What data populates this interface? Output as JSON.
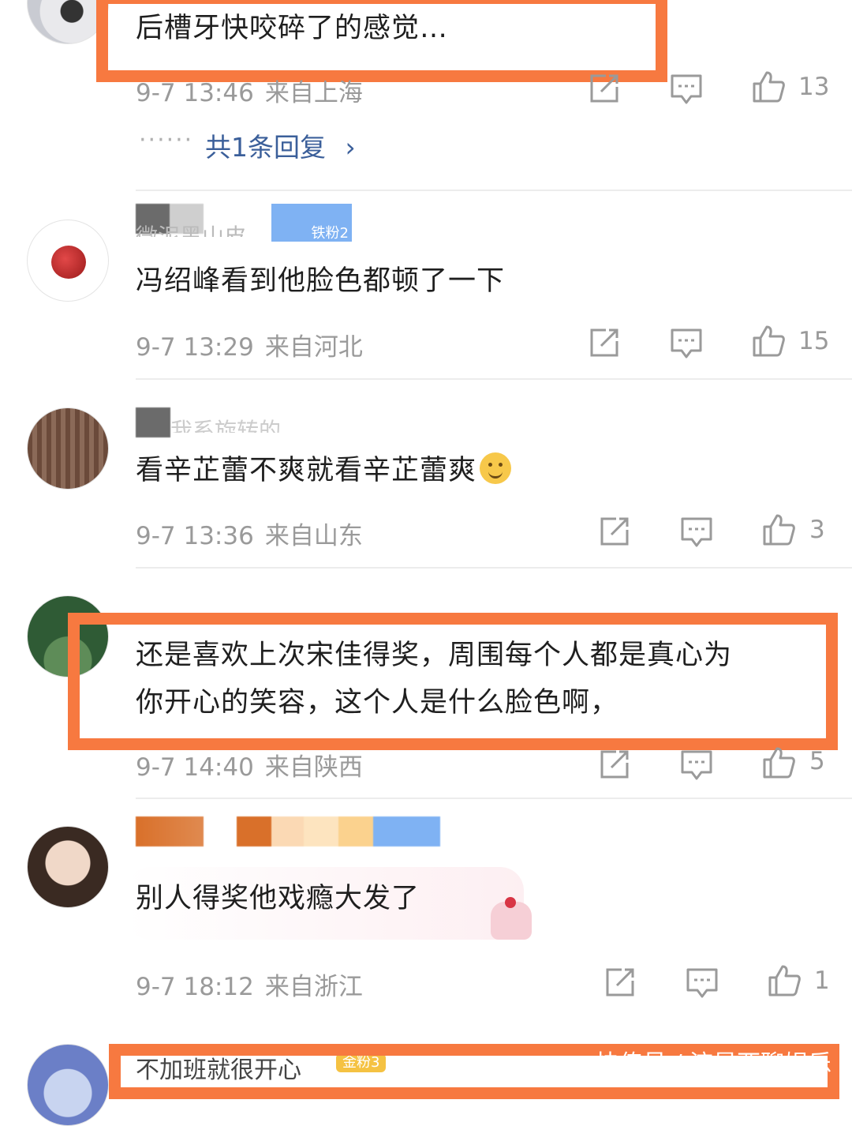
{
  "comments": [
    {
      "text": "后槽牙快咬碎了的感觉…",
      "date": "9-7 13:46",
      "location": "来自上海",
      "likes": "13",
      "reply_link": "共1条回复",
      "reply_dots": "······"
    },
    {
      "name": "微泥黑山皮",
      "badge": "铁粉2",
      "text": "冯绍峰看到他脸色都顿了一下",
      "date": "9-7 13:29",
      "location": "来自河北",
      "likes": "15"
    },
    {
      "name": "我系旋转的",
      "text": "看辛芷蕾不爽就看辛芷蕾爽",
      "date": "9-7 13:36",
      "location": "来自山东",
      "likes": "3"
    },
    {
      "text_line1": "还是喜欢上次宋佳得奖，周围每个人都是真心为",
      "text_line2": "你开心的笑容，这个人是什么脸色啊，",
      "date": "9-7 14:40",
      "location": "来自陕西",
      "likes": "5"
    },
    {
      "text": "别人得奖他戏瘾大发了",
      "date": "9-7 18:12",
      "location": "来自浙江",
      "likes": "1"
    },
    {
      "name": "不加班就很开心",
      "badge": "金粉3"
    }
  ],
  "watermark": "快传号 / 流星西聊娱乐",
  "colors": {
    "highlight": "#f77940",
    "link": "#3b5f9a",
    "meta": "#9a9a9a"
  },
  "icons": [
    "share-icon",
    "comment-icon",
    "thumbs-up-icon",
    "chevron-right-icon"
  ]
}
